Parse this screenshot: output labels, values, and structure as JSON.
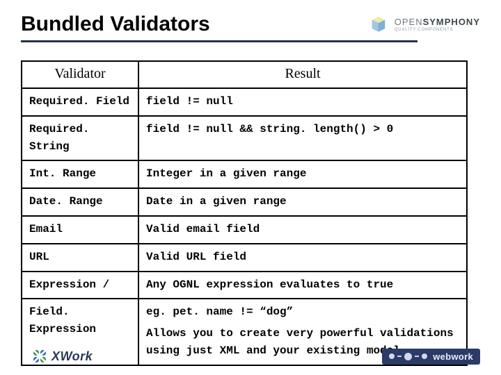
{
  "header": {
    "title": "Bundled Validators",
    "brand_name_light": "OPEN",
    "brand_name_bold": "SYMPHONY",
    "brand_tagline": "QUALITY COMPONENTS"
  },
  "table": {
    "headers": {
      "col1": "Validator",
      "col2": "Result"
    },
    "rows": [
      {
        "validator": "Required. Field",
        "result": "field != null"
      },
      {
        "validator": "Required. String",
        "result": "field != null && string. length() > 0"
      },
      {
        "validator": "Int. Range",
        "result": "Integer in a given range"
      },
      {
        "validator": "Date. Range",
        "result": "Date in a given range"
      },
      {
        "validator": "Email",
        "result": "Valid email field"
      },
      {
        "validator": "URL",
        "result": "Valid URL field"
      },
      {
        "validator": "Expression /",
        "result": "Any OGNL expression evaluates to true"
      },
      {
        "validator": "Field. Expression",
        "result_line1": "eg. pet. name != “dog”",
        "result_line2": "Allows you to create very powerful validations using just XML and your existing model"
      }
    ]
  },
  "footer": {
    "xwork": "XWork",
    "webwork": "webwork"
  }
}
